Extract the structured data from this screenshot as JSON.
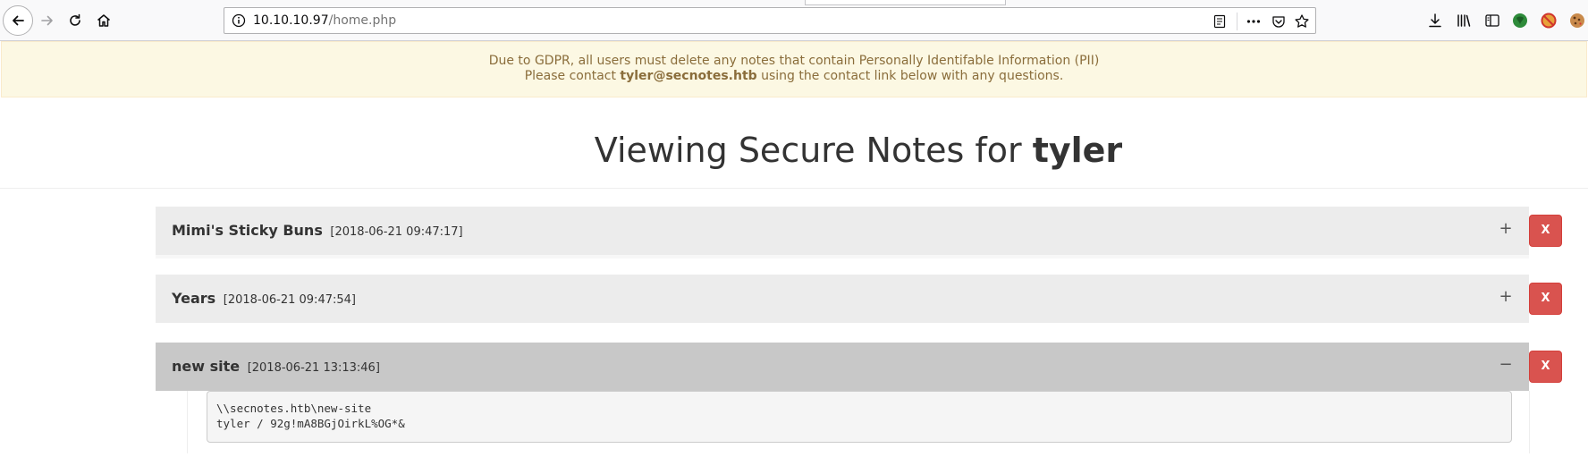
{
  "browser": {
    "url_host": "10.10.10.97",
    "url_path": "/home.php"
  },
  "banner": {
    "line1": "Due to GDPR, all users must delete any notes that contain Personally Identifable Information (PII)",
    "line2_prefix": "Please contact ",
    "line2_email": "tyler@secnotes.htb",
    "line2_suffix": " using the contact link below with any questions."
  },
  "heading": {
    "prefix": "Viewing Secure Notes for ",
    "user": "tyler"
  },
  "notes": [
    {
      "title": "Mimi's Sticky Buns",
      "date": "[2018-06-21 09:47:17]",
      "toggle": "+",
      "delete_label": "X"
    },
    {
      "title": "Years",
      "date": "[2018-06-21 09:47:54]",
      "toggle": "+",
      "delete_label": "X"
    },
    {
      "title": "new site",
      "date": "[2018-06-21 13:13:46]",
      "toggle": "−",
      "delete_label": "X",
      "body_line1": "\\\\secnotes.htb\\new-site",
      "body_line2": "tyler / 92g!mA8BGjOirkL%OG*&"
    }
  ],
  "colors": {
    "banner_bg": "#fcf8e3",
    "banner_text": "#8a6d3b",
    "delete_button": "#d9534f",
    "note_header": "#ececec",
    "note_header_open": "#c8c8c8"
  }
}
